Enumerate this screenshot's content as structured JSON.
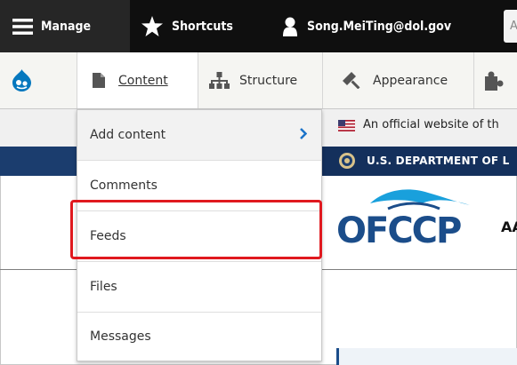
{
  "toolbar": {
    "manage_label": "Manage",
    "shortcuts_label": "Shortcuts",
    "user_label": "Song.MeiTing@dol.gov",
    "search_partial": "A"
  },
  "tray": {
    "content_label": "Content",
    "structure_label": "Structure",
    "appearance_label": "Appearance"
  },
  "dropdown": {
    "items": [
      {
        "label": "Add content"
      },
      {
        "label": "Comments"
      },
      {
        "label": "Feeds"
      },
      {
        "label": "Files"
      },
      {
        "label": "Messages"
      }
    ]
  },
  "page": {
    "official_banner": "An official website of th",
    "department": "U.S. DEPARTMENT OF L",
    "logo_text": "OFCCP",
    "heading_partial": "AA"
  },
  "colors": {
    "toolbar_bg": "#0f0f0f",
    "navy": "#14305c",
    "highlight_red": "#e0191f",
    "drupal_blue": "#0678be"
  }
}
